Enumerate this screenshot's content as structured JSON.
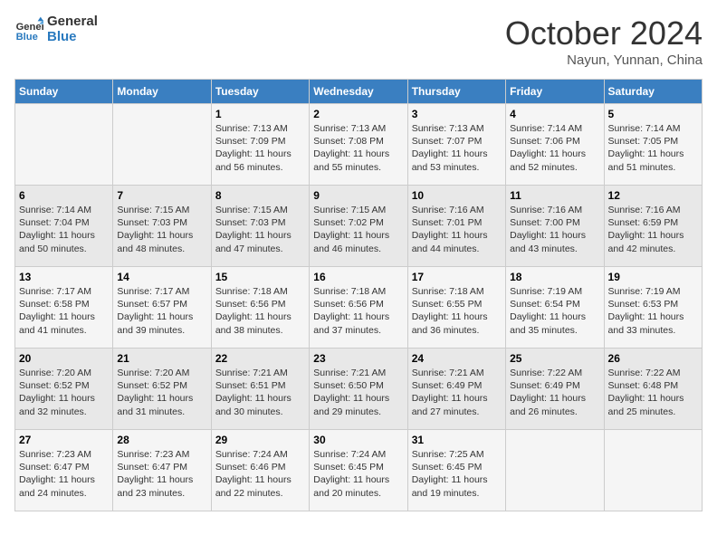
{
  "header": {
    "logo_line1": "General",
    "logo_line2": "Blue",
    "month": "October 2024",
    "location": "Nayun, Yunnan, China"
  },
  "weekdays": [
    "Sunday",
    "Monday",
    "Tuesday",
    "Wednesday",
    "Thursday",
    "Friday",
    "Saturday"
  ],
  "weeks": [
    [
      {
        "day": "",
        "info": ""
      },
      {
        "day": "",
        "info": ""
      },
      {
        "day": "1",
        "info": "Sunrise: 7:13 AM\nSunset: 7:09 PM\nDaylight: 11 hours and 56 minutes."
      },
      {
        "day": "2",
        "info": "Sunrise: 7:13 AM\nSunset: 7:08 PM\nDaylight: 11 hours and 55 minutes."
      },
      {
        "day": "3",
        "info": "Sunrise: 7:13 AM\nSunset: 7:07 PM\nDaylight: 11 hours and 53 minutes."
      },
      {
        "day": "4",
        "info": "Sunrise: 7:14 AM\nSunset: 7:06 PM\nDaylight: 11 hours and 52 minutes."
      },
      {
        "day": "5",
        "info": "Sunrise: 7:14 AM\nSunset: 7:05 PM\nDaylight: 11 hours and 51 minutes."
      }
    ],
    [
      {
        "day": "6",
        "info": "Sunrise: 7:14 AM\nSunset: 7:04 PM\nDaylight: 11 hours and 50 minutes."
      },
      {
        "day": "7",
        "info": "Sunrise: 7:15 AM\nSunset: 7:03 PM\nDaylight: 11 hours and 48 minutes."
      },
      {
        "day": "8",
        "info": "Sunrise: 7:15 AM\nSunset: 7:03 PM\nDaylight: 11 hours and 47 minutes."
      },
      {
        "day": "9",
        "info": "Sunrise: 7:15 AM\nSunset: 7:02 PM\nDaylight: 11 hours and 46 minutes."
      },
      {
        "day": "10",
        "info": "Sunrise: 7:16 AM\nSunset: 7:01 PM\nDaylight: 11 hours and 44 minutes."
      },
      {
        "day": "11",
        "info": "Sunrise: 7:16 AM\nSunset: 7:00 PM\nDaylight: 11 hours and 43 minutes."
      },
      {
        "day": "12",
        "info": "Sunrise: 7:16 AM\nSunset: 6:59 PM\nDaylight: 11 hours and 42 minutes."
      }
    ],
    [
      {
        "day": "13",
        "info": "Sunrise: 7:17 AM\nSunset: 6:58 PM\nDaylight: 11 hours and 41 minutes."
      },
      {
        "day": "14",
        "info": "Sunrise: 7:17 AM\nSunset: 6:57 PM\nDaylight: 11 hours and 39 minutes."
      },
      {
        "day": "15",
        "info": "Sunrise: 7:18 AM\nSunset: 6:56 PM\nDaylight: 11 hours and 38 minutes."
      },
      {
        "day": "16",
        "info": "Sunrise: 7:18 AM\nSunset: 6:56 PM\nDaylight: 11 hours and 37 minutes."
      },
      {
        "day": "17",
        "info": "Sunrise: 7:18 AM\nSunset: 6:55 PM\nDaylight: 11 hours and 36 minutes."
      },
      {
        "day": "18",
        "info": "Sunrise: 7:19 AM\nSunset: 6:54 PM\nDaylight: 11 hours and 35 minutes."
      },
      {
        "day": "19",
        "info": "Sunrise: 7:19 AM\nSunset: 6:53 PM\nDaylight: 11 hours and 33 minutes."
      }
    ],
    [
      {
        "day": "20",
        "info": "Sunrise: 7:20 AM\nSunset: 6:52 PM\nDaylight: 11 hours and 32 minutes."
      },
      {
        "day": "21",
        "info": "Sunrise: 7:20 AM\nSunset: 6:52 PM\nDaylight: 11 hours and 31 minutes."
      },
      {
        "day": "22",
        "info": "Sunrise: 7:21 AM\nSunset: 6:51 PM\nDaylight: 11 hours and 30 minutes."
      },
      {
        "day": "23",
        "info": "Sunrise: 7:21 AM\nSunset: 6:50 PM\nDaylight: 11 hours and 29 minutes."
      },
      {
        "day": "24",
        "info": "Sunrise: 7:21 AM\nSunset: 6:49 PM\nDaylight: 11 hours and 27 minutes."
      },
      {
        "day": "25",
        "info": "Sunrise: 7:22 AM\nSunset: 6:49 PM\nDaylight: 11 hours and 26 minutes."
      },
      {
        "day": "26",
        "info": "Sunrise: 7:22 AM\nSunset: 6:48 PM\nDaylight: 11 hours and 25 minutes."
      }
    ],
    [
      {
        "day": "27",
        "info": "Sunrise: 7:23 AM\nSunset: 6:47 PM\nDaylight: 11 hours and 24 minutes."
      },
      {
        "day": "28",
        "info": "Sunrise: 7:23 AM\nSunset: 6:47 PM\nDaylight: 11 hours and 23 minutes."
      },
      {
        "day": "29",
        "info": "Sunrise: 7:24 AM\nSunset: 6:46 PM\nDaylight: 11 hours and 22 minutes."
      },
      {
        "day": "30",
        "info": "Sunrise: 7:24 AM\nSunset: 6:45 PM\nDaylight: 11 hours and 20 minutes."
      },
      {
        "day": "31",
        "info": "Sunrise: 7:25 AM\nSunset: 6:45 PM\nDaylight: 11 hours and 19 minutes."
      },
      {
        "day": "",
        "info": ""
      },
      {
        "day": "",
        "info": ""
      }
    ]
  ]
}
